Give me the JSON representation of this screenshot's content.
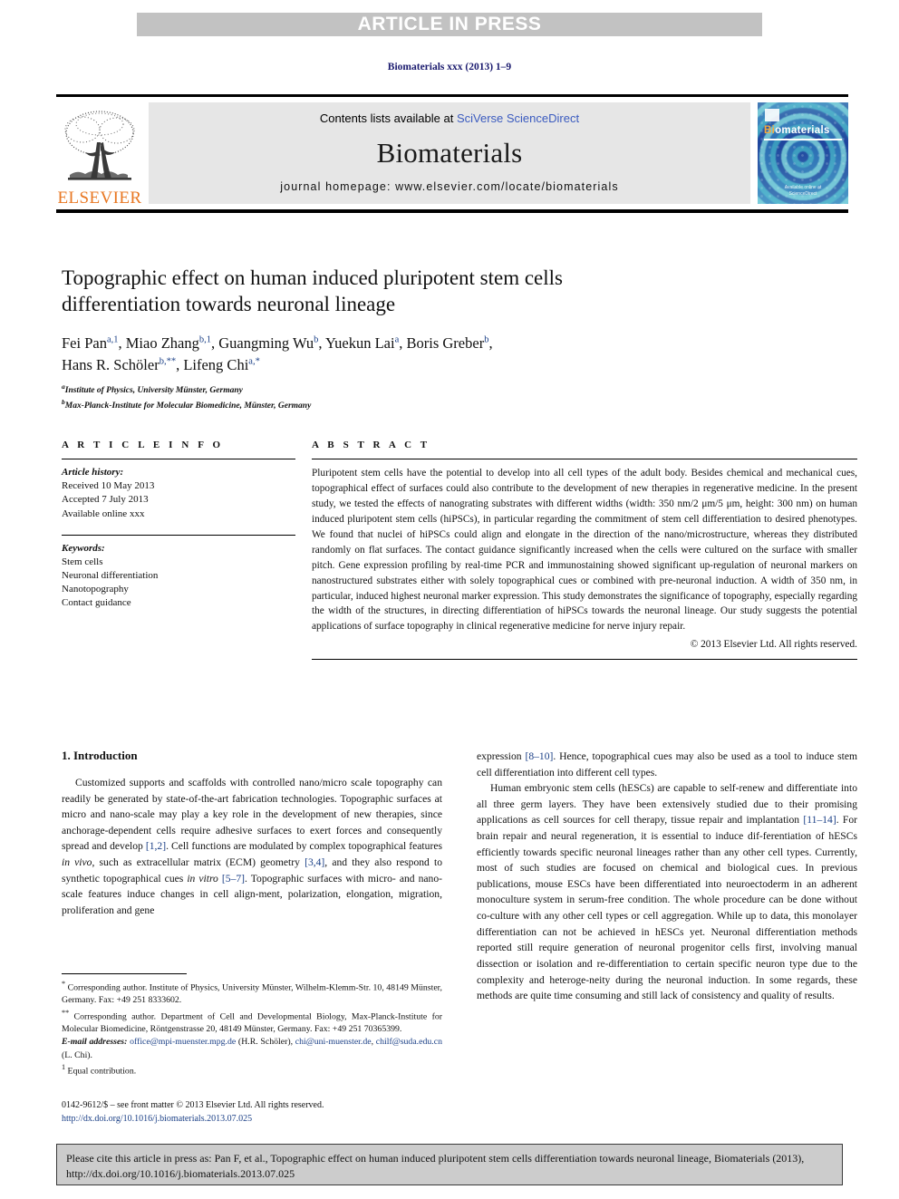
{
  "banner": {
    "text": "ARTICLE IN PRESS"
  },
  "running_head": "Biomaterials xxx (2013) 1–9",
  "masthead": {
    "contents_prefix": "Contents lists available at ",
    "contents_link": "SciVerse ScienceDirect",
    "journal_title": "Biomaterials",
    "homepage": "journal homepage: www.elsevier.com/locate/biomaterials",
    "publisher_wordmark": "ELSEVIER",
    "cover": {
      "title_part1": "Bi",
      "title_part2": "omaterials",
      "footer_line1": "Available online at",
      "footer_line2": "ScienceDirect"
    }
  },
  "article": {
    "title": "Topographic effect on human induced pluripotent stem cells differentiation towards neuronal lineage",
    "authors_line1_a": "Fei Pan",
    "authors_line1_a_sup": "a,1",
    "authors_line1_b": ", Miao Zhang",
    "authors_line1_b_sup": "b,1",
    "authors_line1_c": ", Guangming Wu",
    "authors_line1_c_sup": "b",
    "authors_line1_d": ", Yuekun Lai",
    "authors_line1_d_sup": "a",
    "authors_line1_e": ", Boris Greber",
    "authors_line1_e_sup": "b",
    "authors_line1_f": ",",
    "authors_line2_a": "Hans R. Schöler",
    "authors_line2_a_sup": "b,**",
    "authors_line2_b": ", Lifeng Chi",
    "authors_line2_b_sup": "a,*",
    "affiliation_a_sup": "a",
    "affiliation_a": "Institute of Physics, University Münster, Germany",
    "affiliation_b_sup": "b",
    "affiliation_b": "Max-Planck-Institute for Molecular Biomedicine, Münster, Germany"
  },
  "article_info": {
    "heading": "A R T I C L E   I N F O",
    "history_label": "Article history:",
    "history": [
      "Received 10 May 2013",
      "Accepted 7 July 2013",
      "Available online xxx"
    ],
    "keywords_label": "Keywords:",
    "keywords": [
      "Stem cells",
      "Neuronal differentiation",
      "Nanotopography",
      "Contact guidance"
    ]
  },
  "abstract": {
    "heading": "A B S T R A C T",
    "text": "Pluripotent stem cells have the potential to develop into all cell types of the adult body. Besides chemical and mechanical cues, topographical effect of surfaces could also contribute to the development of new therapies in regenerative medicine. In the present study, we tested the effects of nanograting substrates with different widths (width: 350 nm/2 μm/5 μm, height: 300 nm) on human induced pluripotent stem cells (hiPSCs), in particular regarding the commitment of stem cell differentiation to desired phenotypes. We found that nuclei of hiPSCs could align and elongate in the direction of the nano/microstructure, whereas they distributed randomly on flat surfaces. The contact guidance significantly increased when the cells were cultured on the surface with smaller pitch. Gene expression profiling by real-time PCR and immunostaining showed significant up-regulation of neuronal markers on nanostructured substrates either with solely topographical cues or combined with pre-neuronal induction. A width of 350 nm, in particular, induced highest neuronal marker expression. This study demonstrates the significance of topography, especially regarding the width of the structures, in directing differentiation of hiPSCs towards the neuronal lineage. Our study suggests the potential applications of surface topography in clinical regenerative medicine for nerve injury repair.",
    "copyright": "© 2013 Elsevier Ltd. All rights reserved."
  },
  "body": {
    "section_number_title": "1. Introduction",
    "left_paragraph_1_before_ref1": "Customized supports and scaffolds with controlled nano/micro scale topography can readily be generated by state-of-the-art fabrication technologies. Topographic surfaces at micro and nano-scale may play a key role in the development of new therapies, since anchorage-dependent cells require adhesive surfaces to exert forces and consequently spread and develop ",
    "ref_1_2": "[1,2]",
    "left_paragraph_1_mid1": ". Cell functions are modulated by complex topographical features ",
    "in_vivo": "in vivo",
    "left_paragraph_1_mid2": ", such as extracellular matrix (ECM) geometry ",
    "ref_3_4": "[3,4]",
    "left_paragraph_1_mid3": ", and they also respond to synthetic topographical cues ",
    "in_vitro": "in vitro",
    "left_paragraph_1_mid4": " ",
    "ref_5_7": "[5–7]",
    "left_paragraph_1_end": ". Topographic surfaces with micro- and nano-scale features induce changes in cell align-ment, polarization, elongation, migration, proliferation and gene",
    "right_paragraph_1_start": "expression ",
    "ref_8_10": "[8–10]",
    "right_paragraph_1_end": ". Hence, topographical cues may also be used as a tool to induce stem cell differentiation into different cell types.",
    "right_paragraph_2_start": "Human embryonic stem cells (hESCs) are capable to self-renew and differentiate into all three germ layers. They have been extensively studied due to their promising applications as cell sources for cell therapy, tissue repair and implantation ",
    "ref_11_14": "[11–14]",
    "right_paragraph_2_end": ". For brain repair and neural regeneration, it is essential to induce dif-ferentiation of hESCs efficiently towards specific neuronal lineages rather than any other cell types. Currently, most of such studies are focused on chemical and biological cues. In previous publications, mouse ESCs have been differentiated into neuroectoderm in an adherent monoculture system in serum-free condition. The whole procedure can be done without co-culture with any other cell types or cell aggregation. While up to data, this monolayer differentiation can not be achieved in hESCs yet. Neuronal differentiation methods reported still require generation of neuronal progenitor cells first, involving manual dissection or isolation and re-differentiation to certain specific neuron type due to the complexity and heteroge-neity during the neuronal induction. In some regards, these methods are quite time consuming and still lack of consistency and quality of results."
  },
  "footnotes": {
    "star_mark": "*",
    "star_text": " Corresponding author. Institute of Physics, University Münster, Wilhelm-Klemm-Str. 10, 48149 Münster, Germany. Fax: +49 251 8333602.",
    "doublestar_mark": "**",
    "doublestar_text": " Corresponding author. Department of Cell and Developmental Biology, Max-Planck-Institute for Molecular Biomedicine, Röntgenstrasse 20, 48149 Münster, Germany. Fax: +49 251 70365399.",
    "email_label": "E-mail addresses:",
    "email_1": "office@mpi-muenster.mpg.de",
    "email_1_owner": " (H.R. Schöler), ",
    "email_2": "chi@uni-muenster.de",
    "email_2_sep": ", ",
    "email_3": "chilf@suda.edu.cn",
    "email_3_owner": " (L. Chi).",
    "equal_mark": "1",
    "equal_text": " Equal contribution."
  },
  "imprint": {
    "line1": "0142-9612/$ – see front matter © 2013 Elsevier Ltd. All rights reserved.",
    "doi": "http://dx.doi.org/10.1016/j.biomaterials.2013.07.025"
  },
  "cite_box": {
    "text": "Please cite this article in press as: Pan F, et al., Topographic effect on human induced pluripotent stem cells differentiation towards neuronal lineage, Biomaterials (2013), http://dx.doi.org/10.1016/j.biomaterials.2013.07.025"
  },
  "colors": {
    "banner_bg": "#c2c2c2",
    "link_blue": "#3b5bbf",
    "ref_blue": "#1a3f86",
    "elsevier_orange": "#E87722",
    "cite_box_bg": "#cccccc",
    "masthead_panel_bg": "#e6e6e6"
  }
}
